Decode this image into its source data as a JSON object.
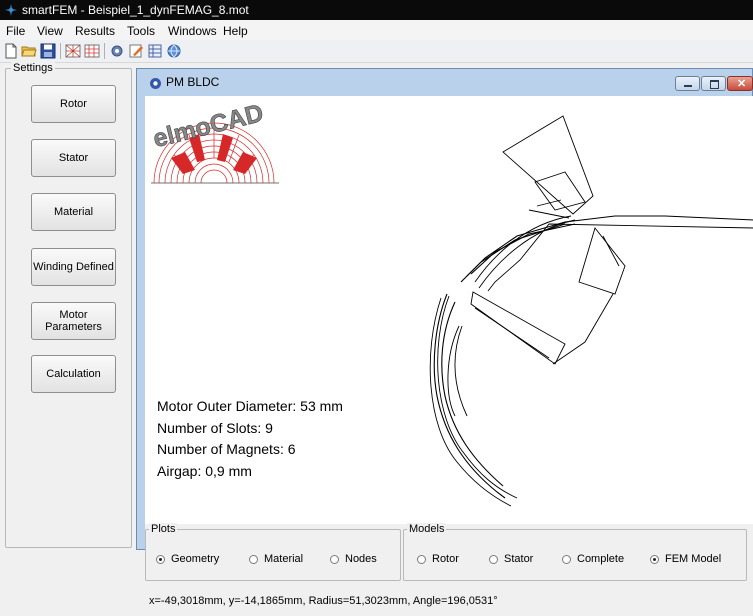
{
  "app": {
    "title": "smartFEM   - Beispiel_1_dynFEMAG_8.mot",
    "menu": [
      "File",
      "View",
      "Results",
      "Tools",
      "Windows",
      "Help"
    ]
  },
  "toolbar": {
    "icons": [
      "new-file-icon",
      "open-folder-icon",
      "save-icon",
      "mesh-icon",
      "grid-icon",
      "gear-icon",
      "edit-icon",
      "table-icon",
      "globe-icon"
    ]
  },
  "settings": {
    "title": "Settings",
    "buttons": [
      "Rotor",
      "Stator",
      "Material",
      "Winding Defined",
      "Motor\nParameters",
      "Calculation"
    ]
  },
  "child_window": {
    "title": "PM BLDC",
    "logo_text": "elmoCAD",
    "info": {
      "outer_diameter": "Motor Outer Diameter: 53 mm",
      "slots": "Number of Slots: 9",
      "magnets": "Number of Magnets: 6",
      "airgap": "Airgap: 0,9 mm"
    },
    "plots": {
      "title": "Plots",
      "options": [
        "Geometry",
        "Material",
        "Nodes"
      ],
      "selected": "Geometry"
    },
    "models": {
      "title": "Models",
      "options": [
        "Rotor",
        "Stator",
        "Complete",
        "FEM Model"
      ],
      "selected": "FEM Model"
    },
    "status": "x=-49,3018mm,   y=-14,1865mm,   Radius=51,3023mm,   Angle=196,0531°"
  },
  "colors": {
    "titlebar": "#0a0a0a",
    "window_frame": "#b9d1ea",
    "logo_red": "#d62828",
    "close_button": "#c74b3c"
  }
}
